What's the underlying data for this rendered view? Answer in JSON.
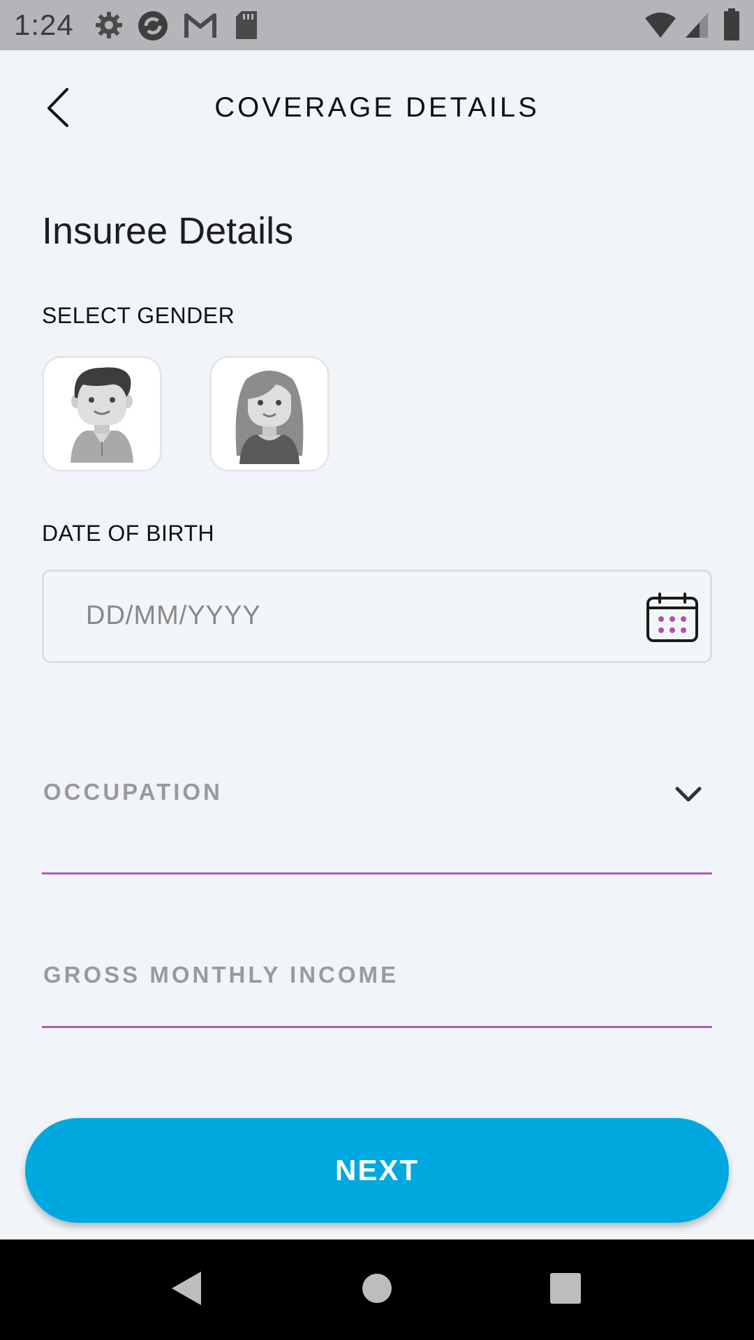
{
  "status_bar": {
    "time": "1:24",
    "left_icons": [
      "settings-icon",
      "sync-icon",
      "gmail-icon",
      "sd-card-icon"
    ],
    "right_icons": [
      "wifi-icon",
      "signal-icon",
      "battery-icon"
    ]
  },
  "app_bar": {
    "title": "COVERAGE DETAILS",
    "back_icon": "chevron-left-icon"
  },
  "form": {
    "section_title": "Insuree Details",
    "gender_label": "SELECT GENDER",
    "gender_options": [
      "male-avatar",
      "female-avatar"
    ],
    "dob_label": "DATE OF BIRTH",
    "dob_placeholder": "DD/MM/YYYY",
    "occupation_placeholder": "OCCUPATION",
    "income_placeholder": "GROSS MONTHLY INCOME"
  },
  "actions": {
    "next_label": "NEXT"
  },
  "colors": {
    "accent": "#00a8e0",
    "underline": "#b25aaf",
    "calendar_dots": "#b04fb0"
  },
  "nav_bar": {
    "icons": [
      "nav-back-icon",
      "nav-home-icon",
      "nav-recents-icon"
    ]
  }
}
